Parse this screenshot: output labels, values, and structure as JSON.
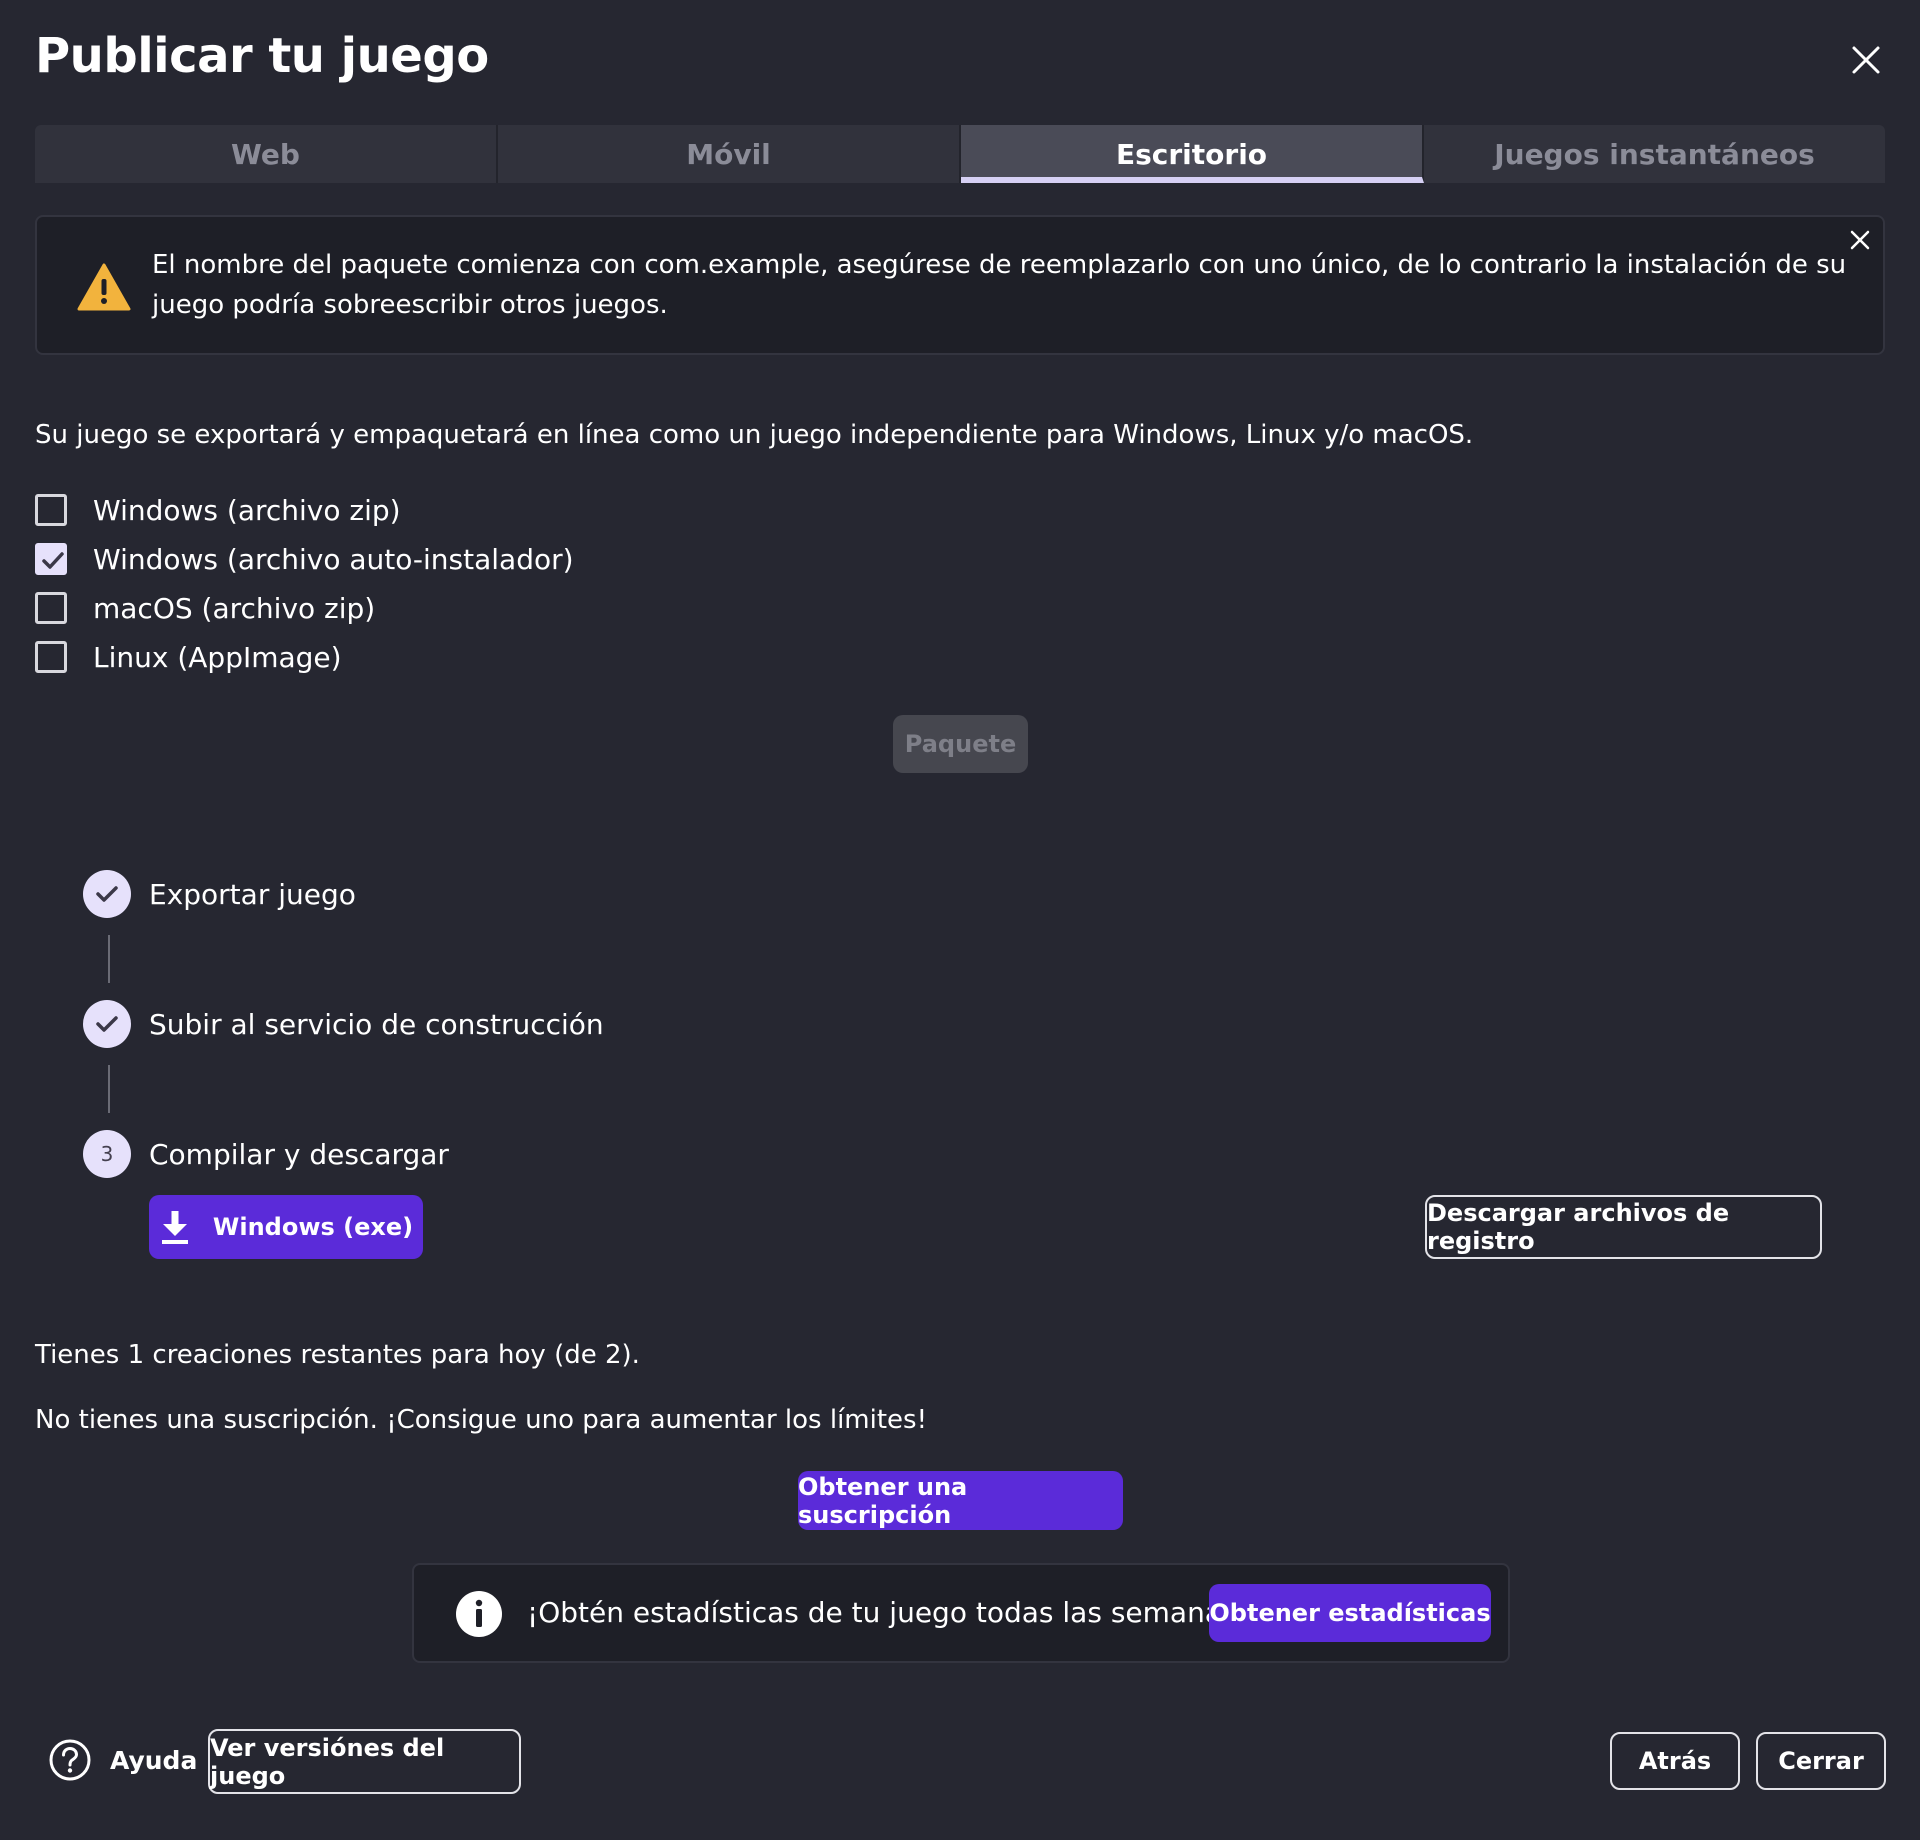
{
  "dialog": {
    "title": "Publicar tu juego"
  },
  "tabs": [
    {
      "label": "Web"
    },
    {
      "label": "Móvil"
    },
    {
      "label": "Escritorio"
    },
    {
      "label": "Juegos instantáneos"
    }
  ],
  "warning": {
    "text": "El nombre del paquete comienza con com.example, asegúrese de reemplazarlo con uno único, de lo contrario la instalación de su juego podría sobreescribir otros juegos."
  },
  "description": "Su juego se exportará y empaquetará en línea como un juego independiente para Windows, Linux y/o macOS.",
  "targets": [
    {
      "label": "Windows (archivo zip)",
      "checked": false
    },
    {
      "label": "Windows (archivo auto-instalador)",
      "checked": true
    },
    {
      "label": "macOS (archivo zip)",
      "checked": false
    },
    {
      "label": "Linux (AppImage)",
      "checked": false
    }
  ],
  "package_button": "Paquete",
  "steps": [
    {
      "label": "Exportar juego",
      "status": "done"
    },
    {
      "label": "Subir al servicio de construcción",
      "status": "done"
    },
    {
      "label": "Compilar y descargar",
      "status": "active",
      "number": "3"
    }
  ],
  "download_button": "Windows (exe)",
  "logs_button": "Descargar archivos de registro",
  "remaining_text": "Tienes 1 creaciones restantes para hoy (de 2).",
  "subscription_text": "No tienes una suscripción. ¡Consigue uno para aumentar los límites!",
  "subscription_button": "Obtener una suscripción",
  "info": {
    "text": "¡Obtén estadísticas de tu juego todas las semanas!",
    "button": "Obtener estadísticas"
  },
  "footer": {
    "help": "Ayuda",
    "versions": "Ver versiónes del juego",
    "back": "Atrás",
    "close": "Cerrar"
  },
  "colors": {
    "background": "#262731",
    "primary": "#5b2bd9",
    "warning_icon": "#f2b33d",
    "check_fill": "#e6e1fb"
  }
}
